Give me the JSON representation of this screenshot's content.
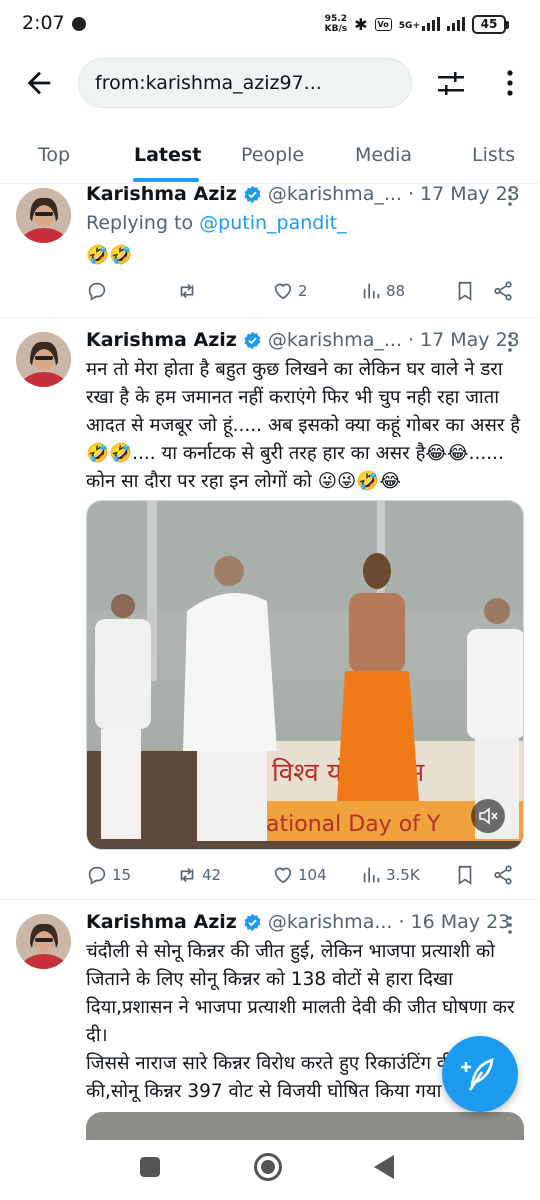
{
  "status_bar": {
    "time": "2:07",
    "speed_value": "95.2",
    "speed_unit": "KB/s",
    "network": "5G+",
    "battery": "45"
  },
  "search": {
    "query": "from:karishma_aziz97..."
  },
  "tabs": [
    {
      "label": "Top",
      "active": false
    },
    {
      "label": "Latest",
      "active": true
    },
    {
      "label": "People",
      "active": false
    },
    {
      "label": "Media",
      "active": false
    },
    {
      "label": "Lists",
      "active": false
    }
  ],
  "tweets": [
    {
      "name": "Karishma Aziz",
      "handle": "@karishma_...",
      "date": "· 17 May 23",
      "reply_prefix": "Replying to",
      "reply_to": "@putin_pandit_",
      "text": "🤣🤣",
      "replies": "",
      "retweets": "",
      "likes": "2",
      "views": "88"
    },
    {
      "name": "Karishma Aziz",
      "handle": "@karishma_...",
      "date": "· 17 May 23",
      "text": "मन तो मेरा होता है बहुत कुछ लिखने का लेकिन घर वाले ने डरा रखा है के हम जमानत नहीं कराएंगे फिर भी चुप नही रहा जाता आदत से मजबूर जो हूं..... अब इसको क्या कहूं गोबर का असर है🤣🤣.... या कर्नाटक से बुरी तरह हार का असर है😂😂...... कोन सा दौरा पर रहा इन लोगों को 😜😜🤣😂",
      "replies": "15",
      "retweets": "42",
      "likes": "104",
      "views": "3.5K"
    },
    {
      "name": "Karishma Aziz",
      "handle": "@karishma...",
      "date": "· 16 May 23",
      "text": "चंदौली से सोनू किन्नर की जीत हुई, लेकिन भाजपा प्रत्याशी को जिताने के लिए सोनू किन्नर को 138 वोटों से हारा दिखा दिया,प्रशासन ने भाजपा प्रत्याशी मालती देवी की जीत घोषणा कर दी।\nजिससे नाराज सारे किन्नर विरोध करते हुए रिकाउंटिंग की मांग की,सोनू किन्नर 397 वोट से विजयी घोषित किया गया"
    }
  ],
  "media_banner_text": "विश्व योग दिवस",
  "media_banner_text2": "rational Day of Y",
  "colors": {
    "accent": "#1d9bf0",
    "text": "#0f1419",
    "secondary": "#536471"
  }
}
